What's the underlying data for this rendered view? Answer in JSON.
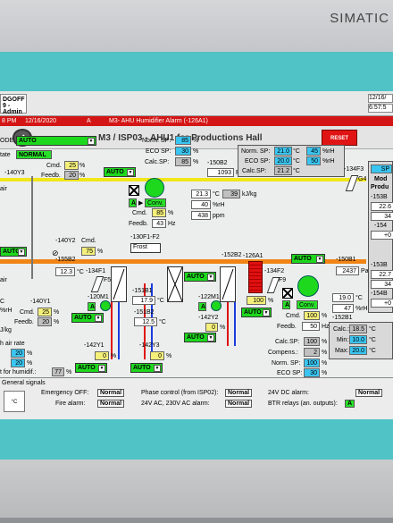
{
  "brand": "SIMATIC",
  "header": {
    "user_top": "DGOFF",
    "user_bottom": "9 - Admin",
    "date_right": "12/16/",
    "time_right": "6:57:5"
  },
  "alarm": {
    "time": "8 PM",
    "date": "12/16/2020",
    "type": "A",
    "text": "M3- AHU Humidifier Alarm (-126A1)"
  },
  "title": "M3 / ISP03 -  AHU1  for Productions Hall",
  "reset_label": "RESET",
  "mode": {
    "label": "ODE",
    "value": "AUTO",
    "state_label": "tate",
    "state_value": "NORMAL"
  },
  "cmd_left": {
    "cmd_label": "Cmd.",
    "cmd": "25",
    "unit": "%",
    "feedb_label": "Feedb.",
    "feedb": "20",
    "unit2": "%",
    "tag": "-140Y3"
  },
  "auto_top": "AUTO",
  "norm_sp": {
    "label": "Norm. SP:",
    "value": "85",
    "unit": "%"
  },
  "eco_sp": {
    "label": "ECO SP:",
    "value": "30",
    "unit": "%"
  },
  "calc_sp": {
    "label": "Calc.SP:",
    "value": "85",
    "unit": "%"
  },
  "pressure1": {
    "tag": "-150B2",
    "value": "1093",
    "unit": "Pa"
  },
  "sp_box": {
    "norm_label": "Norm. SP:",
    "norm_t": "21.0",
    "norm_h": "45",
    "eco_label": "ECO SP:",
    "eco_t": "20.0",
    "eco_h": "50",
    "calc_label": "Calc.SP:",
    "calc_t": "21.2",
    "unit_t": "°C",
    "unit_h": "%rH"
  },
  "f3": {
    "tag": "-134F3",
    "code": "G4"
  },
  "supply": {
    "temp": "21.3",
    "temp_unit": "°C",
    "enthalpy": "39",
    "enthalpy_unit": "kJ/kg",
    "humid": "40",
    "humid_unit": "%rH",
    "co2": "438",
    "co2_unit": "ppm"
  },
  "fan1": {
    "label_a": "A",
    "conv": "Conv.",
    "cmd_label": "Cmd.",
    "cmd": "85",
    "unit": "%",
    "feedb_label": "Feedb.",
    "feedb": "43",
    "feedb_unit": "Hz"
  },
  "damper2": {
    "tag": "-140Y2",
    "cmd_label": "Cmd.",
    "cmd": "75",
    "unit": "%",
    "drop": "AUTO"
  },
  "outside": {
    "label": "air",
    "label2": "air"
  },
  "f1": {
    "tag": "-155B2",
    "temp": "12.3",
    "unit": "°C",
    "filter_tag": "-134F1",
    "code": "F5"
  },
  "frost": {
    "tag": "-130F1-F2",
    "label": "Frost"
  },
  "drop_auto2": "AUTO",
  "preheat": {
    "tag": "-151B1",
    "temp": "17.9",
    "unit": "°C",
    "pump": "-120M1"
  },
  "heat_tag": {
    "tag": "-151B2",
    "temp": "12.5",
    "unit": "°C"
  },
  "heater2": {
    "tag": "-152B2",
    "pump": "-122M1",
    "valve": "-142Y2",
    "valve_pct": "0",
    "unit": "%"
  },
  "humidifier": {
    "tag": "-126A1",
    "pct": "100",
    "unit": "%",
    "drop": "AUTO"
  },
  "f2": {
    "tag": "-134F2",
    "code": "F9"
  },
  "fan2": {
    "label_a": "A",
    "conv": "Conv.",
    "cmd_label": "Cmd.",
    "cmd": "100",
    "unit": "%",
    "feedb_label": "Feedb.",
    "feedb": "50",
    "feedb_unit": "Hz",
    "drop": "AUTO"
  },
  "pressure2": {
    "tag": "-150B1",
    "value": "2437",
    "unit": "Pa"
  },
  "return": {
    "temp": "19.0",
    "temp_unit": "°C",
    "humid": "47",
    "humid_unit": "%rH",
    "tag": "-152B1"
  },
  "left_lower": {
    "c": "C",
    "rh": "%rH",
    "tag": "-140Y1",
    "cmd_label": "Cmd.",
    "cmd": "25",
    "unit": "%",
    "feedb_label": "Feedb.",
    "feedb": "20",
    "kj": "J/kg",
    "drop": "AUTO"
  },
  "fresh": {
    "label": "h air rate",
    "v1": "20",
    "v2": "20",
    "unit": "%"
  },
  "valves": {
    "v1_tag": "-142Y1",
    "v1": "0",
    "v2_tag": "-142Y3",
    "v2": "0",
    "unit": "%",
    "drop1": "AUTO",
    "drop2": "AUTO"
  },
  "humid_sp": {
    "label": "t for humidif.:",
    "value": "77",
    "unit": "%"
  },
  "calc_block": {
    "calc_label": "Calc.SP:",
    "calc": "100",
    "comp_label": "Compens.:",
    "comp": "2",
    "norm_label": "Norm. SP:",
    "norm": "100",
    "eco_label": "ECO SP:",
    "eco": "30",
    "unit": "%"
  },
  "minmax": {
    "calc_label": "Calc.:",
    "calc": "18.5",
    "min_label": "Min:",
    "min": "10.0",
    "max_label": "Max:",
    "max": "20.0",
    "unit": "°C"
  },
  "side": {
    "sp_label": "SP",
    "mode_label": "Mod",
    "prod_label": "Produ",
    "t1": "-153B",
    "v1": "22.6",
    "v1b": "34",
    "t2": "-154",
    "v2": "+0",
    "t3": "-153B",
    "v3": "22.7",
    "v3b": "34",
    "t4": "-154B",
    "v4": "+0"
  },
  "signals": {
    "title": "General signals",
    "unit": "°C",
    "emerg_label": "Emergency OFF:",
    "emerg": "Normal",
    "fire_label": "Fire alarm:",
    "fire": "Normal",
    "phase_label": "Phase control (from ISP02):",
    "phase": "Normal",
    "ac_label": "24V AC, 230V AC alarm:",
    "ac": "Normal",
    "dc_label": "24V DC alarm:",
    "dc": "Normal",
    "btr_label": "BTR relays (an. outputs):",
    "btr": "A"
  }
}
